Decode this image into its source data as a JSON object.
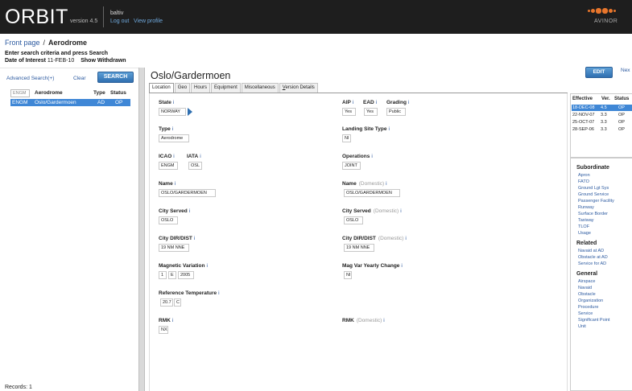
{
  "header": {
    "app_name": "ORBIT",
    "version": "version 4.5",
    "username": "baltiv",
    "logout": "Log out",
    "view_profile": "View profile",
    "brand": "AVINOR",
    "accent": "#e8762c"
  },
  "breadcrumb": {
    "home": "Front page",
    "separator": "/",
    "current": "Aerodrome"
  },
  "search_hint": "Enter search criteria and press Search",
  "date_of_interest": {
    "label": "Date of Interest",
    "value": "11-FEB-10",
    "show_withdrawn": "Show Withdrawn"
  },
  "left_panel": {
    "advanced_search": "Advanced Search(+)",
    "clear": "Clear",
    "search_button": "SEARCH",
    "columns": {
      "code": "ENGM",
      "aerodrome": "Aerodrome",
      "type": "Type",
      "status": "Status"
    },
    "rows": [
      {
        "code": "ENGM",
        "aerodrome": "Oslo/Gardermoen",
        "type": "AD",
        "status": "OP"
      }
    ],
    "records_label": "Records:",
    "records_count": "1"
  },
  "main": {
    "title": "Oslo/Gardermoen",
    "edit_button": "EDIT",
    "next_link": "Nex",
    "tabs": [
      {
        "label": "Location",
        "active": true
      },
      {
        "label": "Geo"
      },
      {
        "label": "Hours"
      },
      {
        "label": "Equipment"
      },
      {
        "label": "Miscellaneous"
      },
      {
        "label": "Version Details",
        "underline": "V",
        "rest": "ersion Details"
      }
    ],
    "info_glyph": "i",
    "domestic_label": "(Domestic)",
    "fields": {
      "state": {
        "label": "State",
        "value": "NORWAY"
      },
      "aip": {
        "label": "AIP",
        "value": "Yes"
      },
      "ead": {
        "label": "EAD",
        "value": "Yes"
      },
      "grading": {
        "label": "Grading",
        "value": "Public"
      },
      "type": {
        "label": "Type",
        "value": "Aerodrome"
      },
      "landing_site_type": {
        "label": "Landing Site Type",
        "value": "NI"
      },
      "icao": {
        "label": "ICAO",
        "value": "ENGM"
      },
      "iata": {
        "label": "IATA",
        "value": "OSL"
      },
      "operations": {
        "label": "Operations",
        "value": "JOINT"
      },
      "name": {
        "label": "Name",
        "value": "OSLO/GARDERMOEN"
      },
      "name_domestic": {
        "label": "Name",
        "value": "OSLO/GARDERMOEN"
      },
      "city_served": {
        "label": "City Served",
        "value": "OSLO"
      },
      "city_served_domestic": {
        "label": "City Served",
        "value": "OSLO"
      },
      "city_dir_dist": {
        "label": "City DIR/DIST",
        "value": "19 NM NNE"
      },
      "city_dir_dist_domestic": {
        "label": "City DIR/DIST",
        "value": "19 NM NNE"
      },
      "mag_var": {
        "label": "Magnetic Variation",
        "deg": "1",
        "dir": "E",
        "year": "2005"
      },
      "mag_var_change": {
        "label": "Mag Var Yearly Change",
        "value": "NI"
      },
      "ref_temp": {
        "label": "Reference Temperature",
        "value": "20.7",
        "unit": "C"
      },
      "rmk": {
        "label": "RMK",
        "value": "NX"
      },
      "rmk_domestic": {
        "label": "RMK"
      }
    }
  },
  "effective_panel": {
    "headers": {
      "effective": "Effective",
      "ver": "Ver.",
      "status": "Status"
    },
    "rows": [
      {
        "date": "18-DEC-08",
        "ver": "4.5",
        "status": "OP",
        "selected": true
      },
      {
        "date": "22-NOV-07",
        "ver": "3.3",
        "status": "OP"
      },
      {
        "date": "25-OCT-07",
        "ver": "3.3",
        "status": "OP"
      },
      {
        "date": "28-SEP-06",
        "ver": "3.3",
        "status": "OP"
      }
    ]
  },
  "related_panel": {
    "subordinate": {
      "title": "Subordinate",
      "items": [
        "Apron",
        "FATO",
        "Ground Lgt Sys",
        "Ground Service",
        "Passenger Facility",
        "Runway",
        "Surface Border",
        "Taxiway",
        "TLOF",
        "Usage"
      ]
    },
    "related": {
      "title": "Related",
      "items": [
        "Navaid at AD",
        "Obstacle at AD",
        "Service for AD"
      ]
    },
    "general": {
      "title": "General",
      "items": [
        "Airspace",
        "Navaid",
        "Obstacle",
        "Organization",
        "Procedure",
        "Service",
        "Significant Point",
        "Unit"
      ]
    }
  }
}
